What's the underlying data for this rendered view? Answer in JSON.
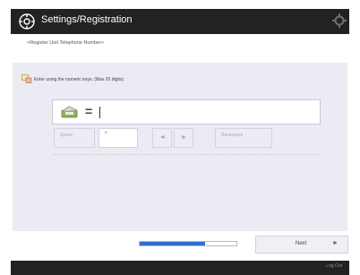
{
  "header": {
    "title": "Settings/Registration",
    "app_icon": "settings-wrench-icon",
    "settings_icon": "gear-icon"
  },
  "page": {
    "subtitle": "<Register Unit Telephone Number>"
  },
  "instruction": {
    "icon": "keypad-hand-icon",
    "text": "Enter using the numeric keys. (Max 20 digits)"
  },
  "input": {
    "icon": "telephone-icon",
    "prefix": "=",
    "value": ""
  },
  "keys": {
    "space": "Space",
    "star": "*",
    "backspace": "Backspace",
    "left_arrow": "◄",
    "right_arrow": "►"
  },
  "footer": {
    "progress_fraction": 0.68,
    "next_label": "Next",
    "next_arrow": "►",
    "logout_label": "Log Out"
  },
  "colors": {
    "titlebar": "#222222",
    "panel": "#ebebf4",
    "progress_fill": "#2f6fcf"
  }
}
